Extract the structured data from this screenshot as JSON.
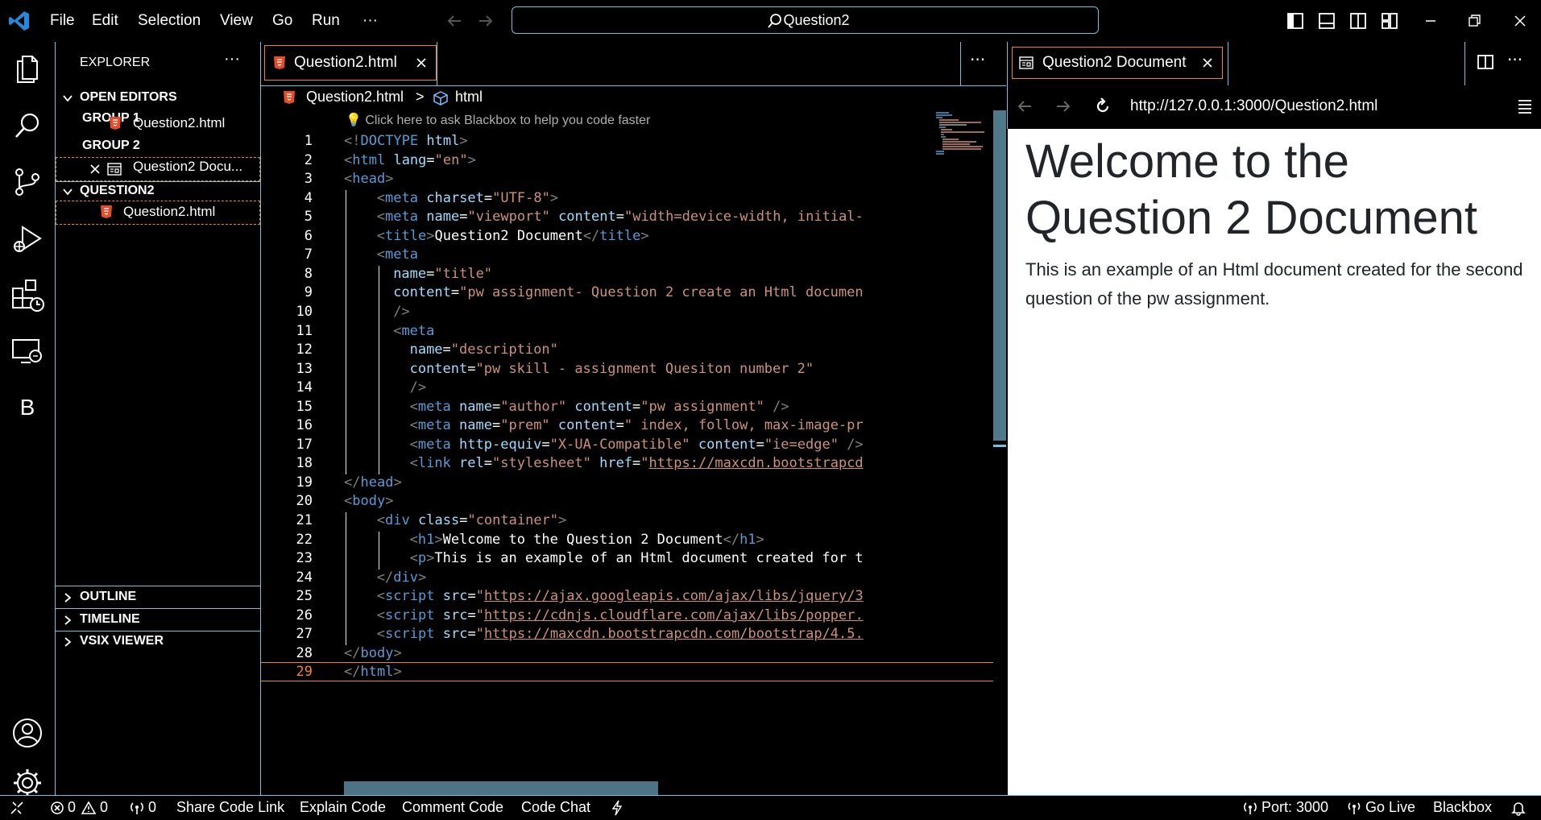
{
  "titlebar": {
    "menu": [
      "File",
      "Edit",
      "Selection",
      "View",
      "Go",
      "Run",
      "···"
    ],
    "command_center": "Question2"
  },
  "activity_bar": {
    "icons": [
      "files-icon",
      "search-icon",
      "source-control-icon",
      "run-debug-icon",
      "extensions-icon",
      "remote-explorer-icon",
      "blackbox-icon",
      "account-icon",
      "settings-gear-icon"
    ],
    "blackbox_letter": "B"
  },
  "sidebar": {
    "title": "EXPLORER",
    "more": "···",
    "open_editors": "OPEN EDITORS",
    "group1": "GROUP 1",
    "group1_file": "Question2.html",
    "group2": "GROUP 2",
    "group2_file": "Question2 Docu...",
    "folder": "QUESTION2",
    "folder_file": "Question2.html",
    "outline": "OUTLINE",
    "timeline": "TIMELINE",
    "vsix": "VSIX VIEWER"
  },
  "editor": {
    "tab_label": "Question2.html",
    "more": "···",
    "breadcrumb_file": "Question2.html",
    "breadcrumb_sep": ">",
    "breadcrumb_symbol": "html",
    "codelens": "Click here to ask Blackbox to help you code faster",
    "lines": [
      {
        "n": "1",
        "indent": 0,
        "parts": [
          [
            "br",
            "<!"
          ],
          [
            "tag",
            "DOCTYPE"
          ],
          [
            "txt",
            " "
          ],
          [
            "attr",
            "html"
          ],
          [
            "br",
            ">"
          ]
        ]
      },
      {
        "n": "2",
        "indent": 0,
        "parts": [
          [
            "br",
            "<"
          ],
          [
            "tag",
            "html"
          ],
          [
            "txt",
            " "
          ],
          [
            "attr",
            "lang"
          ],
          [
            "txt",
            "="
          ],
          [
            "str",
            "\"en\""
          ],
          [
            "br",
            ">"
          ]
        ]
      },
      {
        "n": "3",
        "indent": 0,
        "parts": [
          [
            "br",
            "<"
          ],
          [
            "tag",
            "head"
          ],
          [
            "br",
            ">"
          ]
        ]
      },
      {
        "n": "4",
        "indent": 4,
        "parts": [
          [
            "br",
            "<"
          ],
          [
            "tag",
            "meta"
          ],
          [
            "txt",
            " "
          ],
          [
            "attr",
            "charset"
          ],
          [
            "txt",
            "="
          ],
          [
            "str",
            "\"UTF-8\""
          ],
          [
            "br",
            ">"
          ]
        ]
      },
      {
        "n": "5",
        "indent": 4,
        "parts": [
          [
            "br",
            "<"
          ],
          [
            "tag",
            "meta"
          ],
          [
            "txt",
            " "
          ],
          [
            "attr",
            "name"
          ],
          [
            "txt",
            "="
          ],
          [
            "str",
            "\"viewport\""
          ],
          [
            "txt",
            " "
          ],
          [
            "attr",
            "content"
          ],
          [
            "txt",
            "="
          ],
          [
            "str",
            "\"width=device-width, initial-"
          ]
        ]
      },
      {
        "n": "6",
        "indent": 4,
        "parts": [
          [
            "br",
            "<"
          ],
          [
            "tag",
            "title"
          ],
          [
            "br",
            ">"
          ],
          [
            "txt",
            "Question2 Document"
          ],
          [
            "br",
            "</"
          ],
          [
            "tag",
            "title"
          ],
          [
            "br",
            ">"
          ]
        ]
      },
      {
        "n": "7",
        "indent": 4,
        "parts": [
          [
            "br",
            "<"
          ],
          [
            "tag",
            "meta"
          ]
        ]
      },
      {
        "n": "8",
        "indent": 6,
        "parts": [
          [
            "attr",
            "name"
          ],
          [
            "txt",
            "="
          ],
          [
            "str",
            "\"title\""
          ]
        ]
      },
      {
        "n": "9",
        "indent": 6,
        "parts": [
          [
            "attr",
            "content"
          ],
          [
            "txt",
            "="
          ],
          [
            "str",
            "\"pw assignment- Question 2 create an Html documen"
          ]
        ]
      },
      {
        "n": "10",
        "indent": 6,
        "parts": [
          [
            "br",
            "/>"
          ]
        ]
      },
      {
        "n": "11",
        "indent": 6,
        "parts": [
          [
            "br",
            "<"
          ],
          [
            "tag",
            "meta"
          ]
        ]
      },
      {
        "n": "12",
        "indent": 8,
        "parts": [
          [
            "attr",
            "name"
          ],
          [
            "txt",
            "="
          ],
          [
            "str",
            "\"description\""
          ]
        ]
      },
      {
        "n": "13",
        "indent": 8,
        "parts": [
          [
            "attr",
            "content"
          ],
          [
            "txt",
            "="
          ],
          [
            "str",
            "\"pw skill - assignment Quesiton number 2\""
          ]
        ]
      },
      {
        "n": "14",
        "indent": 8,
        "parts": [
          [
            "br",
            "/>"
          ]
        ]
      },
      {
        "n": "15",
        "indent": 8,
        "parts": [
          [
            "br",
            "<"
          ],
          [
            "tag",
            "meta"
          ],
          [
            "txt",
            " "
          ],
          [
            "attr",
            "name"
          ],
          [
            "txt",
            "="
          ],
          [
            "str",
            "\"author\""
          ],
          [
            "txt",
            " "
          ],
          [
            "attr",
            "content"
          ],
          [
            "txt",
            "="
          ],
          [
            "str",
            "\"pw assignment\""
          ],
          [
            "txt",
            " "
          ],
          [
            "br",
            "/>"
          ]
        ]
      },
      {
        "n": "16",
        "indent": 8,
        "parts": [
          [
            "br",
            "<"
          ],
          [
            "tag",
            "meta"
          ],
          [
            "txt",
            " "
          ],
          [
            "attr",
            "name"
          ],
          [
            "txt",
            "="
          ],
          [
            "str",
            "\"prem\""
          ],
          [
            "txt",
            " "
          ],
          [
            "attr",
            "content"
          ],
          [
            "txt",
            "="
          ],
          [
            "str",
            "\" index, follow, max-image-pr"
          ]
        ]
      },
      {
        "n": "17",
        "indent": 8,
        "parts": [
          [
            "br",
            "<"
          ],
          [
            "tag",
            "meta"
          ],
          [
            "txt",
            " "
          ],
          [
            "attr",
            "http-equiv"
          ],
          [
            "txt",
            "="
          ],
          [
            "str",
            "\"X-UA-Compatible\""
          ],
          [
            "txt",
            " "
          ],
          [
            "attr",
            "content"
          ],
          [
            "txt",
            "="
          ],
          [
            "str",
            "\"ie=edge\""
          ],
          [
            "txt",
            " "
          ],
          [
            "br",
            "/>"
          ]
        ]
      },
      {
        "n": "18",
        "indent": 8,
        "parts": [
          [
            "br",
            "<"
          ],
          [
            "tag",
            "link"
          ],
          [
            "txt",
            " "
          ],
          [
            "attr",
            "rel"
          ],
          [
            "txt",
            "="
          ],
          [
            "str",
            "\"stylesheet\""
          ],
          [
            "txt",
            " "
          ],
          [
            "attr",
            "href"
          ],
          [
            "txt",
            "="
          ],
          [
            "str",
            "\""
          ],
          [
            "url",
            "https://maxcdn.bootstrapcd"
          ]
        ]
      },
      {
        "n": "19",
        "indent": 0,
        "parts": [
          [
            "br",
            "</"
          ],
          [
            "tag",
            "head"
          ],
          [
            "br",
            ">"
          ]
        ]
      },
      {
        "n": "20",
        "indent": 0,
        "parts": [
          [
            "br",
            "<"
          ],
          [
            "tag",
            "body"
          ],
          [
            "br",
            ">"
          ]
        ]
      },
      {
        "n": "21",
        "indent": 4,
        "parts": [
          [
            "br",
            "<"
          ],
          [
            "tag",
            "div"
          ],
          [
            "txt",
            " "
          ],
          [
            "attr",
            "class"
          ],
          [
            "txt",
            "="
          ],
          [
            "str",
            "\"container\""
          ],
          [
            "br",
            ">"
          ]
        ]
      },
      {
        "n": "22",
        "indent": 8,
        "parts": [
          [
            "br",
            "<"
          ],
          [
            "tag",
            "h1"
          ],
          [
            "br",
            ">"
          ],
          [
            "txt",
            "Welcome to the Question 2 Document"
          ],
          [
            "br",
            "</"
          ],
          [
            "tag",
            "h1"
          ],
          [
            "br",
            ">"
          ]
        ]
      },
      {
        "n": "23",
        "indent": 8,
        "parts": [
          [
            "br",
            "<"
          ],
          [
            "tag",
            "p"
          ],
          [
            "br",
            ">"
          ],
          [
            "txt",
            "This is an example of an Html document created for t"
          ]
        ]
      },
      {
        "n": "24",
        "indent": 4,
        "parts": [
          [
            "br",
            "</"
          ],
          [
            "tag",
            "div"
          ],
          [
            "br",
            ">"
          ]
        ]
      },
      {
        "n": "25",
        "indent": 4,
        "parts": [
          [
            "br",
            "<"
          ],
          [
            "tag",
            "script"
          ],
          [
            "txt",
            " "
          ],
          [
            "attr",
            "src"
          ],
          [
            "txt",
            "="
          ],
          [
            "str",
            "\""
          ],
          [
            "url",
            "https://ajax.googleapis.com/ajax/libs/jquery/3"
          ]
        ]
      },
      {
        "n": "26",
        "indent": 4,
        "parts": [
          [
            "br",
            "<"
          ],
          [
            "tag",
            "script"
          ],
          [
            "txt",
            " "
          ],
          [
            "attr",
            "src"
          ],
          [
            "txt",
            "="
          ],
          [
            "str",
            "\""
          ],
          [
            "url",
            "https://cdnjs.cloudflare.com/ajax/libs/popper."
          ]
        ]
      },
      {
        "n": "27",
        "indent": 4,
        "parts": [
          [
            "br",
            "<"
          ],
          [
            "tag",
            "script"
          ],
          [
            "txt",
            " "
          ],
          [
            "attr",
            "src"
          ],
          [
            "txt",
            "="
          ],
          [
            "str",
            "\""
          ],
          [
            "url",
            "https://maxcdn.bootstrapcdn.com/bootstrap/4.5."
          ]
        ]
      },
      {
        "n": "28",
        "indent": 0,
        "parts": [
          [
            "br",
            "</"
          ],
          [
            "tag",
            "body"
          ],
          [
            "br",
            ">"
          ]
        ]
      },
      {
        "n": "29",
        "indent": 0,
        "parts": [
          [
            "br",
            "</"
          ],
          [
            "tag",
            "html"
          ],
          [
            "br",
            ">"
          ]
        ]
      }
    ]
  },
  "preview": {
    "tab_label": "Question2 Document",
    "url": "http://127.0.0.1:3000/Question2.html",
    "heading": "Welcome to the Question 2 Document",
    "paragraph": "This is an example of an Html document created for the second question of the pw assignment."
  },
  "statusbar": {
    "errors": "0",
    "warnings": "0",
    "ports": "0",
    "share": "Share Code Link",
    "explain": "Explain Code",
    "comment": "Comment Code",
    "chat": "Code Chat",
    "port": "Port: 3000",
    "golive": "Go Live",
    "blackbox": "Blackbox"
  },
  "colors": {
    "contrast_border": "#6fc3df",
    "active_border": "#f38518",
    "tag": "#569cd6",
    "attr": "#9cdcfe",
    "string": "#ce9178",
    "vscode_blue": "#2489db"
  }
}
